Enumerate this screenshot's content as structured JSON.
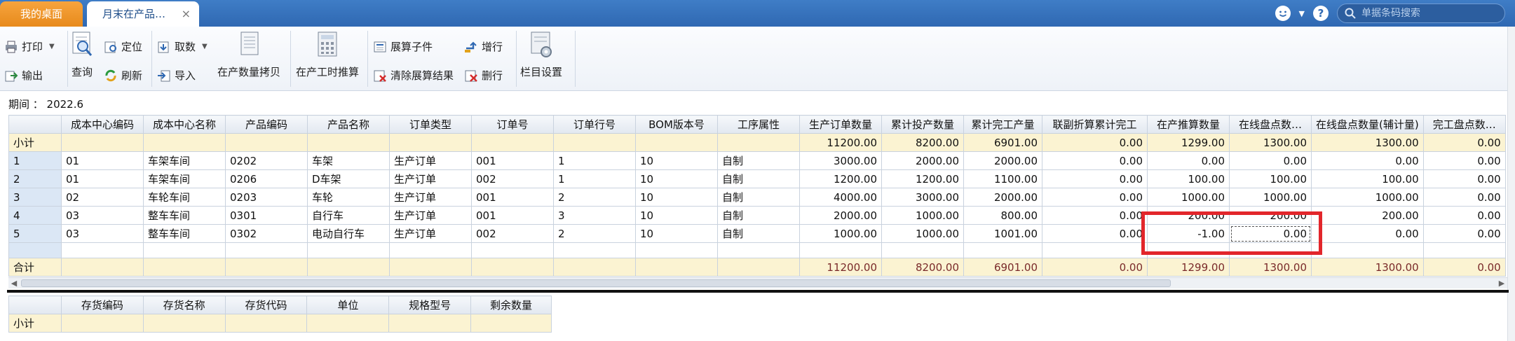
{
  "tabs": {
    "home_label": "我的桌面",
    "active_label": "月末在产品…",
    "close_glyph": "×"
  },
  "topbar": {
    "search_placeholder": "单据条码搜索",
    "help_glyph": "?",
    "caret_glyph": "▼"
  },
  "toolbar": {
    "print": "打印",
    "export": "输出",
    "query": "查询",
    "locate": "定位",
    "refresh": "刷新",
    "fetch": "取数",
    "import": "导入",
    "copy_wip_qty": "在产数量拷贝",
    "wip_hours_calc": "在产工时推算",
    "expand_sub": "展算子件",
    "clear_expand": "清除展算结果",
    "add_row": "增行",
    "delete_row": "删行",
    "column_settings": "栏目设置"
  },
  "period": {
    "label": "期间 ： 2022.6"
  },
  "main_grid": {
    "columns": [
      "",
      "成本中心编码",
      "成本中心名称",
      "产品编码",
      "产品名称",
      "订单类型",
      "订单号",
      "订单行号",
      "BOM版本号",
      "工序属性",
      "生产订单数量",
      "累计投产数量",
      "累计完工产量",
      "联副折算累计完工",
      "在产推算数量",
      "在线盘点数…",
      "在线盘点数量(辅计量)",
      "完工盘点数…"
    ],
    "subtotal_row": [
      "小计",
      "",
      "",
      "",
      "",
      "",
      "",
      "",
      "",
      "",
      "11200.00",
      "8200.00",
      "6901.00",
      "0.00",
      "1299.00",
      "1300.00",
      "1300.00",
      "0.00"
    ],
    "rows": [
      [
        "1",
        "01",
        "车架车间",
        "0202",
        "车架",
        "生产订单",
        "001",
        "1",
        "10",
        "自制",
        "3000.00",
        "2000.00",
        "2000.00",
        "0.00",
        "0.00",
        "0.00",
        "0.00",
        "0.00"
      ],
      [
        "2",
        "01",
        "车架车间",
        "0206",
        "D车架",
        "生产订单",
        "002",
        "1",
        "10",
        "自制",
        "1200.00",
        "1200.00",
        "1100.00",
        "0.00",
        "100.00",
        "100.00",
        "100.00",
        "0.00"
      ],
      [
        "3",
        "02",
        "车轮车间",
        "0203",
        "车轮",
        "生产订单",
        "001",
        "2",
        "10",
        "自制",
        "4000.00",
        "3000.00",
        "2000.00",
        "0.00",
        "1000.00",
        "1000.00",
        "1000.00",
        "0.00"
      ],
      [
        "4",
        "03",
        "整车车间",
        "0301",
        "自行车",
        "生产订单",
        "001",
        "3",
        "10",
        "自制",
        "2000.00",
        "1000.00",
        "800.00",
        "0.00",
        "200.00",
        "200.00",
        "200.00",
        "0.00"
      ],
      [
        "5",
        "03",
        "整车车间",
        "0302",
        "电动自行车",
        "生产订单",
        "002",
        "2",
        "10",
        "自制",
        "1000.00",
        "1000.00",
        "1001.00",
        "0.00",
        "-1.00",
        "0.00",
        "0.00",
        "0.00"
      ]
    ],
    "total_row": [
      "合计",
      "",
      "",
      "",
      "",
      "",
      "",
      "",
      "",
      "",
      "11200.00",
      "8200.00",
      "6901.00",
      "0.00",
      "1299.00",
      "1300.00",
      "1300.00",
      "0.00"
    ]
  },
  "sub_grid": {
    "columns": [
      "",
      "存货编码",
      "存货名称",
      "存货代码",
      "单位",
      "规格型号",
      "剩余数量"
    ],
    "subtotal_row": [
      "小计",
      "",
      "",
      "",
      "",
      "",
      ""
    ]
  },
  "colors": {
    "highlight_border": "#e2262b",
    "topbar_blue": "#2f68b2",
    "home_tab_orange": "#f09a2c",
    "subtotal_bg": "#fbf3d2"
  }
}
